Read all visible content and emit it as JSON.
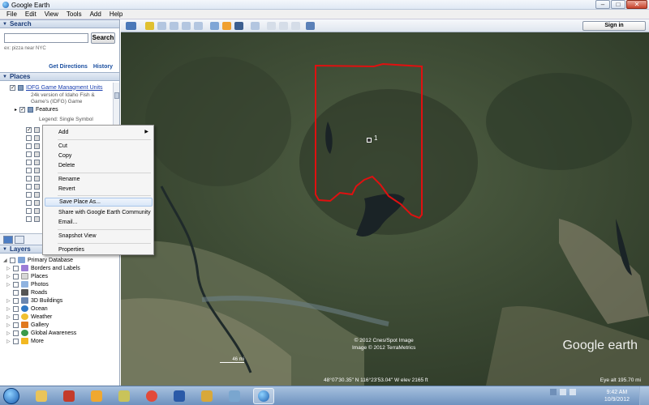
{
  "window": {
    "title": "Google Earth"
  },
  "menubar": [
    "File",
    "Edit",
    "View",
    "Tools",
    "Add",
    "Help"
  ],
  "search": {
    "header": "Search",
    "button": "Search",
    "hint": "ex: pizza near NYC",
    "links": [
      "Get Directions",
      "History"
    ]
  },
  "places": {
    "header": "Places",
    "layer_title": "IDFG Game Managment Units",
    "layer_sub1": "24k version of Idaho Fish &",
    "layer_sub2": "Game's (IDFG) Game",
    "features": "Features",
    "legend": "Legend: Single Symbol"
  },
  "context_menu": {
    "items": [
      "Add",
      "Cut",
      "Copy",
      "Delete",
      "Rename",
      "Revert",
      "Save Place As...",
      "Share with Google Earth Community",
      "Email...",
      "Snapshot View",
      "Properties"
    ],
    "highlighted": "Save Place As..."
  },
  "layers": {
    "header": "Layers",
    "primary": "Primary Database",
    "items": [
      "Borders and Labels",
      "Places",
      "Photos",
      "Roads",
      "3D Buildings",
      "Ocean",
      "Weather",
      "Gallery",
      "Global Awareness",
      "More"
    ]
  },
  "toolbar": {
    "signin": "Sign in"
  },
  "map": {
    "placemark_label": "1",
    "credits_line1": "© 2012 Cnes/Spot Image",
    "credits_line2": "Image © 2012 TerraMetrics",
    "status": "48°07'30.35\" N  116°23'53.04\" W  elev  2165 ft",
    "eye_alt": "Eye alt  195.70 mi",
    "scale": "46 mi",
    "watermark": "Google earth"
  },
  "taskbar": {
    "time": "9:42 AM",
    "date": "10/9/2012"
  },
  "colors": {
    "polygon": "#e01010",
    "accent": "#1b3c78"
  }
}
